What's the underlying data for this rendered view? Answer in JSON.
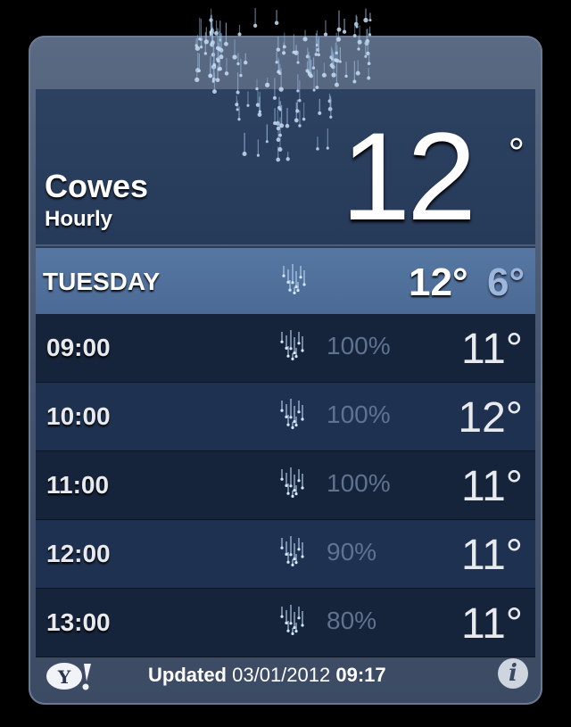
{
  "location": {
    "city": "Cowes",
    "subtitle": "Hourly"
  },
  "current": {
    "temp": "12",
    "degree": "°"
  },
  "day": {
    "name": "TUESDAY",
    "high": "12°",
    "low": "6°"
  },
  "hourly": [
    {
      "time": "09:00",
      "precip": "100%",
      "temp": "11°"
    },
    {
      "time": "10:00",
      "precip": "100%",
      "temp": "12°"
    },
    {
      "time": "11:00",
      "precip": "100%",
      "temp": "11°"
    },
    {
      "time": "12:00",
      "precip": "90%",
      "temp": "11°"
    },
    {
      "time": "13:00",
      "precip": "80%",
      "temp": "11°"
    }
  ],
  "footer": {
    "updated_label": "Updated",
    "date": "03/01/2012",
    "time": "09:17",
    "info_symbol": "i"
  },
  "icons": {
    "condition": "rain-icon",
    "provider": "yahoo-logo",
    "info": "info-icon"
  },
  "colors": {
    "day_row": "#4b6b96",
    "low_temp": "#9db7dc",
    "precip_text": "#5f7290"
  }
}
